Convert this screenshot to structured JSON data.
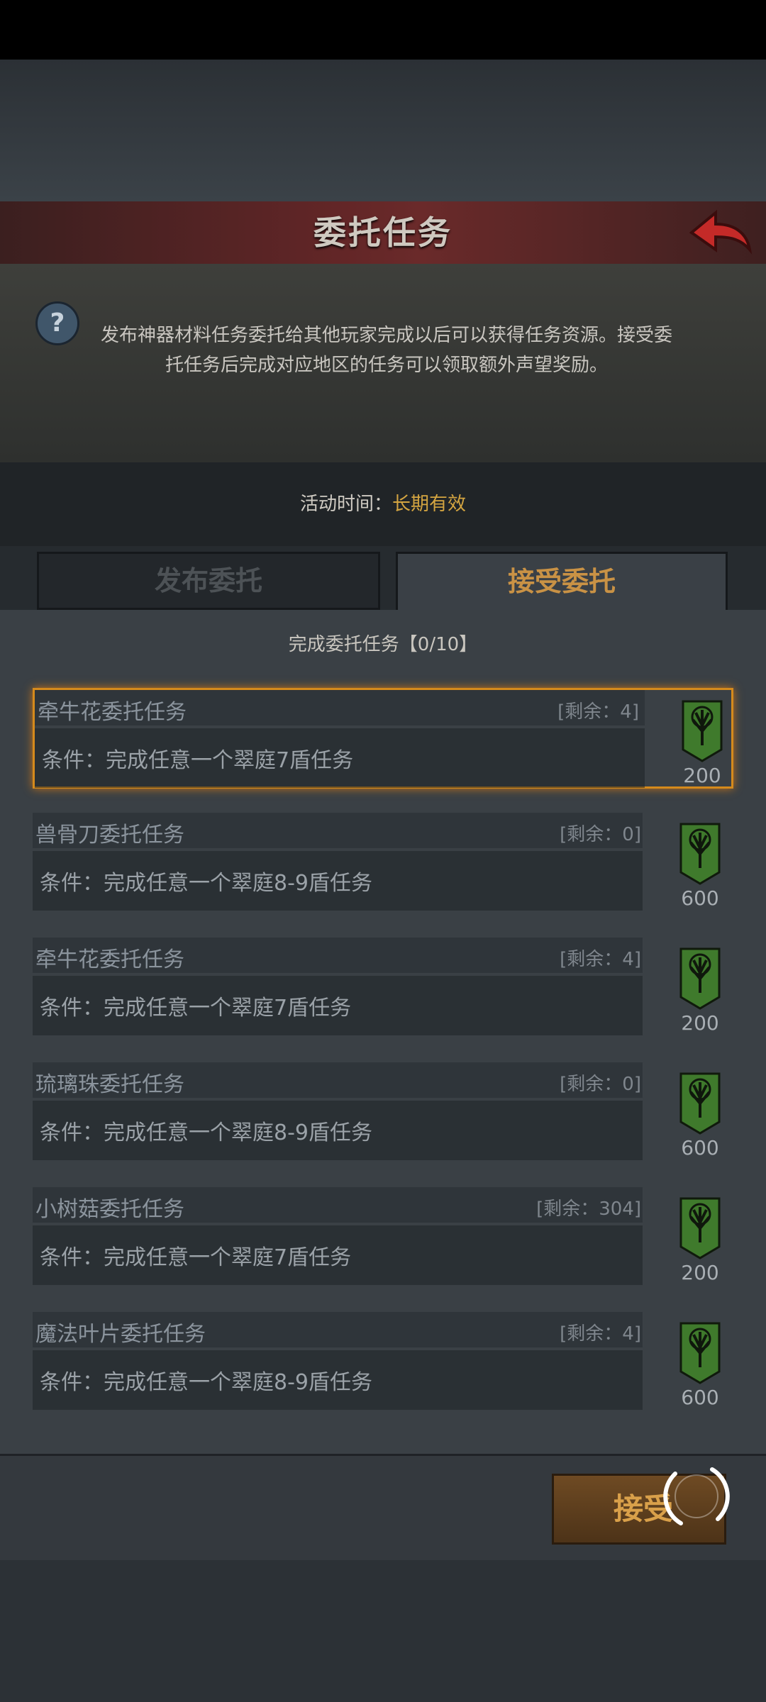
{
  "header": {
    "title": "委托任务"
  },
  "info": {
    "description": "发布神器材料任务委托给其他玩家完成以后可以获得任务资源。接受委托任务后完成对应地区的任务可以领取额外声望奖励。",
    "time_label": "活动时间：",
    "time_value": "长期有效"
  },
  "tabs": {
    "publish": "发布委托",
    "accept": "接受委托"
  },
  "progress": "完成委托任务【0/10】",
  "tasks": [
    {
      "name": "牵牛花委托任务",
      "remaining": "[剩余：4]",
      "condition": "条件：完成任意一个翠庭7盾任务",
      "reward": "200"
    },
    {
      "name": "兽骨刀委托任务",
      "remaining": "[剩余：0]",
      "condition": "条件：完成任意一个翠庭8-9盾任务",
      "reward": "600"
    },
    {
      "name": "牵牛花委托任务",
      "remaining": "[剩余：4]",
      "condition": "条件：完成任意一个翠庭7盾任务",
      "reward": "200"
    },
    {
      "name": "琉璃珠委托任务",
      "remaining": "[剩余：0]",
      "condition": "条件：完成任意一个翠庭8-9盾任务",
      "reward": "600"
    },
    {
      "name": "小树菇委托任务",
      "remaining": "[剩余：304]",
      "condition": "条件：完成任意一个翠庭7盾任务",
      "reward": "200"
    },
    {
      "name": "魔法叶片委托任务",
      "remaining": "[剩余：4]",
      "condition": "条件：完成任意一个翠庭8-9盾任务",
      "reward": "600"
    }
  ],
  "footer": {
    "accept_label": "接受"
  },
  "icons": {
    "back": "back-arrow-icon",
    "help": "question-icon",
    "reward": "tree-banner-icon",
    "loading": "loading-ring-icon"
  },
  "colors": {
    "accent": "#d4a541",
    "title_bar": "#632627",
    "reward_banner": "#3f7a2c",
    "selected_border": "#d58a1c"
  }
}
